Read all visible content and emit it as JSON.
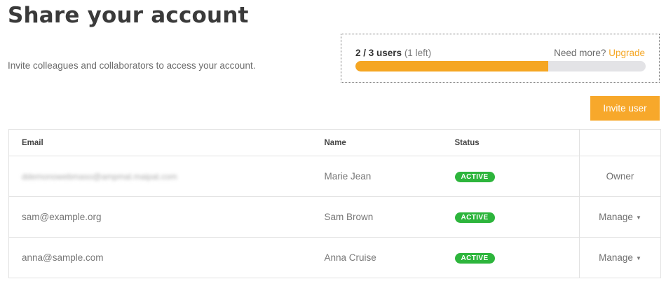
{
  "header": {
    "title": "Share your account",
    "subtitle": "Invite colleagues and collaborators to access your account."
  },
  "usage": {
    "count_label": "2 / 3 users",
    "left_label": "(1 left)",
    "need_more_label": "Need more?",
    "upgrade_label": "Upgrade",
    "used_fraction": 0.664,
    "colors": {
      "fill": "#f5a623",
      "track": "#e3e3e6"
    }
  },
  "actions": {
    "invite_label": "Invite user"
  },
  "table": {
    "columns": {
      "email": "Email",
      "name": "Name",
      "status": "Status",
      "action": ""
    },
    "rows": [
      {
        "email": "ddemonowebmaso@ampmal.maipat.com",
        "email_blurred": true,
        "name": "Marie Jean",
        "status": "ACTIVE",
        "action": "Owner",
        "action_type": "text"
      },
      {
        "email": "sam@example.org",
        "email_blurred": false,
        "name": "Sam Brown",
        "status": "ACTIVE",
        "action": "Manage",
        "action_type": "menu"
      },
      {
        "email": "anna@sample.com",
        "email_blurred": false,
        "name": "Anna Cruise",
        "status": "ACTIVE",
        "action": "Manage",
        "action_type": "menu"
      }
    ]
  },
  "icons": {
    "manage_caret": "caret-down-icon"
  },
  "colors": {
    "accent": "#f7a82b",
    "status_active": "#2db53c"
  }
}
